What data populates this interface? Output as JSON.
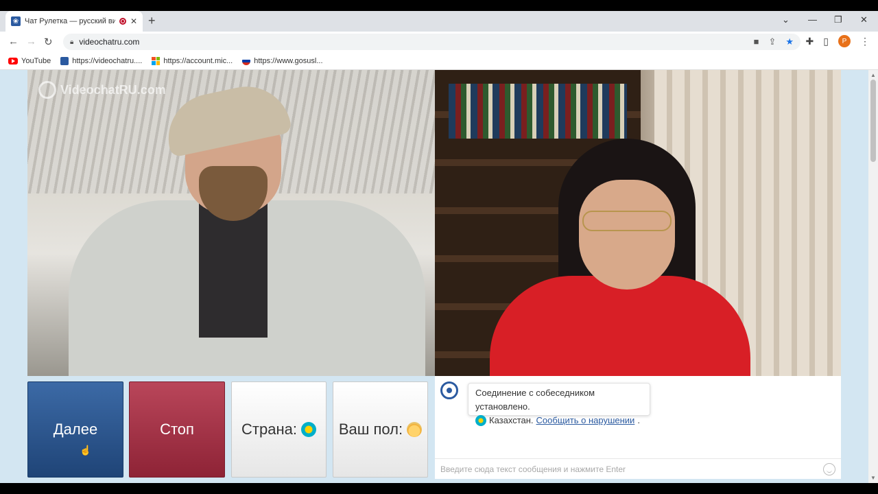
{
  "browser": {
    "tab_title": "Чат Рулетка — русский видео",
    "tab_close": "✕",
    "new_tab": "+",
    "url": "videochatru.com",
    "avatar_letter": "P",
    "window_controls": {
      "dropdown": "⌄",
      "minimize": "—",
      "restore": "❐",
      "close": "✕"
    },
    "bookmarks": [
      {
        "label": "YouTube"
      },
      {
        "label": "https://videochatru...."
      },
      {
        "label": "https://account.mic..."
      },
      {
        "label": "https://www.gosusl..."
      }
    ]
  },
  "page": {
    "watermark": "VideochatRU.com",
    "buttons": {
      "next": "Далее",
      "stop": "Стоп",
      "country": "Страна:",
      "gender": "Ваш пол:"
    },
    "chat": {
      "system_message_line1": "Соединение с собеседником установлено.",
      "system_message_country": "Казахстан.",
      "report_link": "Сообщить о нарушении",
      "period": ".",
      "input_placeholder": "Введите сюда текст сообщения и нажмите Enter"
    }
  },
  "colors": {
    "next_button": "#2b5a95",
    "stop_button": "#a0334a",
    "page_background": "#d3e6f2",
    "link": "#2b5aa0"
  }
}
